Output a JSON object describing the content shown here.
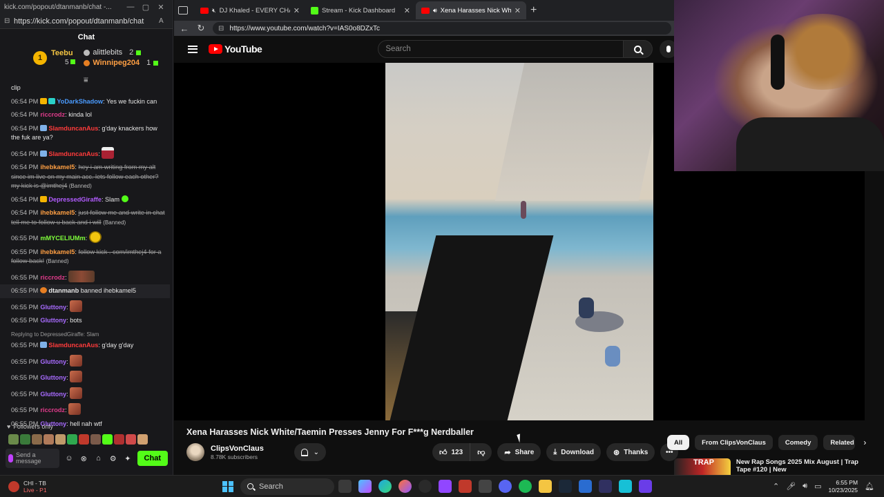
{
  "chat_window": {
    "title": "kick.com/popout/dtanmanb/chat -...",
    "url": "https://kick.com/popout/dtanmanb/chat",
    "header": "Chat",
    "leaderboard": {
      "first": {
        "rank": "1",
        "name": "Teebu",
        "count": "5"
      },
      "second": {
        "name": "alittlebits",
        "count": "2"
      },
      "third": {
        "name": "Winnipeg204",
        "count": "1"
      }
    },
    "messages": [
      {
        "time": "",
        "user": "",
        "text": "clip",
        "color": ""
      },
      {
        "time": "06:54 PM",
        "user": "YoDarkShadow",
        "text": "Yes we fuckin can",
        "color": "c-blue",
        "badges": [
          "crown",
          "sub"
        ]
      },
      {
        "time": "06:54 PM",
        "user": "riccrodz",
        "text": "kinda lol",
        "color": "c-pink"
      },
      {
        "time": "06:54 PM",
        "user": "SlamduncanAus",
        "text": "g'day knackers how the fuk are ya?",
        "color": "c-red",
        "badges": [
          "mod"
        ]
      },
      {
        "time": "06:54 PM",
        "user": "SlamduncanAus",
        "text": "",
        "color": "c-red",
        "badges": [
          "mod"
        ],
        "emote": "figure"
      },
      {
        "time": "06:54 PM",
        "user": "ihebkamel5",
        "text": "hey i am writing from my alt since im live on my main acc. lets follow each other? my kick is @imthej4",
        "color": "c-orange",
        "strike": true,
        "banned": "(Banned)"
      },
      {
        "time": "06:54 PM",
        "user": "DepressedGiraffe",
        "text": "Slam",
        "color": "c-purple",
        "badges": [
          "crown"
        ],
        "emote": "heart"
      },
      {
        "time": "06:54 PM",
        "user": "ihebkamel5",
        "text": "just follow me and write in chat tell me to follow u back and i will",
        "color": "c-orange",
        "strike": true,
        "banned": "(Banned)"
      },
      {
        "time": "06:55 PM",
        "user": "mMYCELIUMm",
        "text": "",
        "color": "c-lime",
        "emote": "cool"
      },
      {
        "time": "06:55 PM",
        "user": "ihebkamel5",
        "text": "follow kick . com/imthej4 for a follow back!",
        "color": "c-orange",
        "strike": true,
        "banned": "(Banned)"
      },
      {
        "time": "06:55 PM",
        "user": "riccrodz",
        "text": "",
        "color": "c-pink",
        "emote": "wide"
      },
      {
        "time": "06:55 PM",
        "user": "dtanmanb",
        "text": "banned ihebkamel5",
        "color": "",
        "system": true
      },
      {
        "time": "06:55 PM",
        "user": "Gluttony",
        "text": "",
        "color": "c-violet",
        "emote": "face"
      },
      {
        "time": "06:55 PM",
        "user": "Gluttony",
        "text": "bots",
        "color": "c-violet"
      },
      {
        "time": "06:55 PM",
        "user": "SlamduncanAus",
        "text": "g'day g'day",
        "color": "c-red",
        "badges": [
          "mod"
        ],
        "reply": "Replying to DepressedGiraffe: Slam"
      },
      {
        "time": "06:55 PM",
        "user": "Gluttony",
        "text": "",
        "color": "c-violet",
        "emote": "face"
      },
      {
        "time": "06:55 PM",
        "user": "Gluttony",
        "text": "",
        "color": "c-violet",
        "emote": "face"
      },
      {
        "time": "06:55 PM",
        "user": "Gluttony",
        "text": "",
        "color": "c-violet",
        "emote": "face"
      },
      {
        "time": "06:55 PM",
        "user": "riccrodz",
        "text": "",
        "color": "c-pink",
        "emote": "face"
      },
      {
        "time": "06:55 PM",
        "user": "Gluttony",
        "text": "hell nah wtf",
        "color": "c-violet"
      }
    ],
    "followers_only": "Followers only",
    "input_placeholder": "Send a message",
    "send_label": "Chat"
  },
  "browser": {
    "tabs": [
      {
        "label": "DJ Khaled - EVERY CHANCE I GET",
        "fav": "yt",
        "muted": true
      },
      {
        "label": "Stream - Kick Dashboard",
        "fav": "kick"
      },
      {
        "label": "Xena Harasses Nick White/Taemin",
        "fav": "yt",
        "active": true,
        "audio": true
      }
    ],
    "url": "https://www.youtube.com/watch?v=IAS0o8DZxTc"
  },
  "youtube": {
    "logo_text": "YouTube",
    "search_placeholder": "Search",
    "video_title": "Xena Harasses Nick White/Taemin Presses Jenny For F***g Nerdballer",
    "channel_name": "ClipsVonClaus",
    "subscribers": "8.78K subscribers",
    "likes": "123",
    "share_label": "Share",
    "download_label": "Download",
    "thanks_label": "Thanks",
    "chips": [
      "All",
      "From ClipsVonClaus",
      "Comedy",
      "Related"
    ],
    "related_title": "New Rap Songs 2025 Mix August | Trap Tape #120 | New",
    "related_thumb_text": "TRAP"
  },
  "taskbar": {
    "stream_name": "CHI - TB",
    "stream_status": "Live - P1",
    "search_label": "Search",
    "time": "6:55 PM",
    "date": "10/23/2025"
  },
  "colors": {
    "kick_green": "#53fc18",
    "yt_red": "#ff0000"
  }
}
